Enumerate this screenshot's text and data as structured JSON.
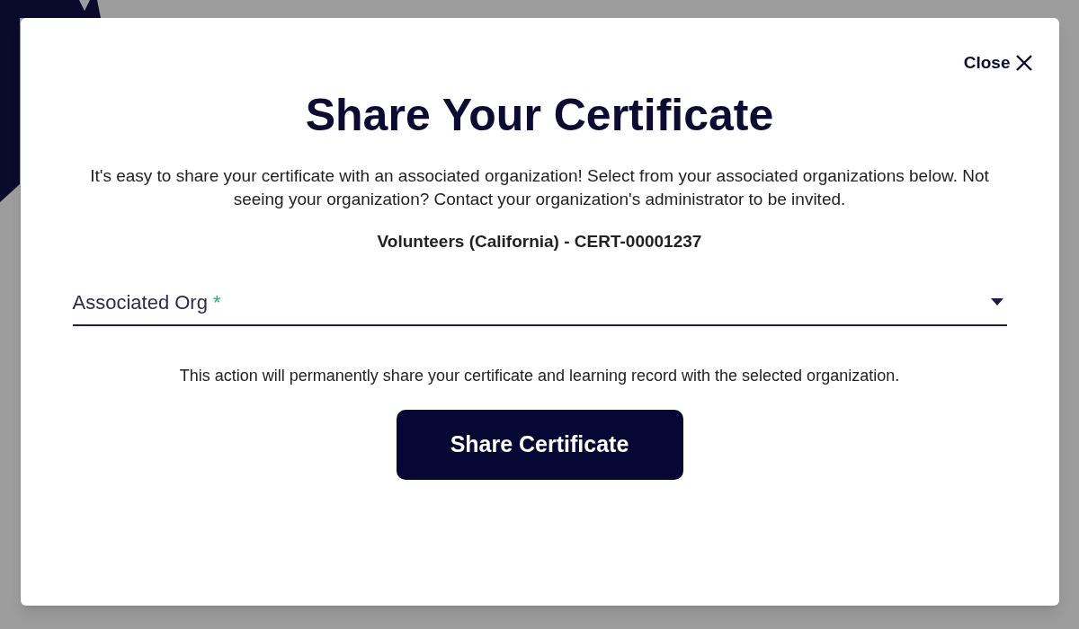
{
  "dialog": {
    "close_label": "Close",
    "title": "Share Your Certificate",
    "intro": "It's easy to share your certificate with an associated organization! Select from your associated organizations below. Not seeing your organization? Contact your organization's administrator to be invited.",
    "certificate": "Volunteers (California) - CERT-00001237",
    "field": {
      "label": "Associated Org",
      "required_mark": "*"
    },
    "notice": "This action will permanently share your certificate and learning record with the selected organization.",
    "submit": "Share Certificate"
  }
}
